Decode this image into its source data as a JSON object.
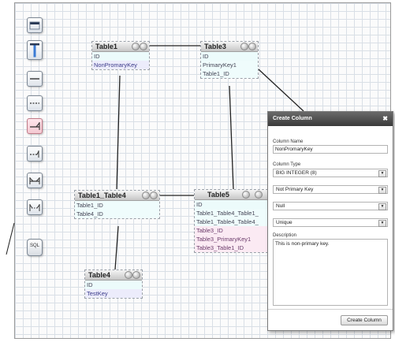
{
  "toolbar": {
    "tools": [
      {
        "name": "new-table-tool"
      },
      {
        "name": "table-column-tool"
      },
      {
        "name": "one-to-one-solid-tool"
      },
      {
        "name": "one-to-one-dashed-tool"
      },
      {
        "name": "one-to-many-solid-tool",
        "active": true
      },
      {
        "name": "one-to-many-dashed-tool"
      },
      {
        "name": "many-to-many-solid-tool"
      },
      {
        "name": "many-to-many-dashed-tool"
      }
    ],
    "sql_label": "SQL"
  },
  "tables": [
    {
      "name": "Table1",
      "rows": [
        {
          "text": "ID",
          "kind": "id"
        },
        {
          "text": "NonPromaryKey",
          "kind": "col"
        }
      ]
    },
    {
      "name": "Table3",
      "rows": [
        {
          "text": "ID",
          "kind": "id"
        },
        {
          "text": "PrimaryKey1",
          "kind": "fk"
        },
        {
          "text": "Table1_ID",
          "kind": "fk"
        }
      ]
    },
    {
      "name": "Table1_Table4",
      "rows": [
        {
          "text": "Table1_ID",
          "kind": "fk"
        },
        {
          "text": "Table4_ID",
          "kind": "fk"
        }
      ]
    },
    {
      "name": "Table5",
      "rows": [
        {
          "text": "ID",
          "kind": "id"
        },
        {
          "text": "Table1_Table4_Table1_",
          "kind": "fk"
        },
        {
          "text": "Table1_Table4_Table4_",
          "kind": "fk"
        },
        {
          "text": "Table3_ID",
          "kind": "pink"
        },
        {
          "text": "Table3_PrimaryKey1",
          "kind": "pink"
        },
        {
          "text": "Table3_Table1_ID",
          "kind": "pink"
        }
      ]
    },
    {
      "name": "Table4",
      "rows": [
        {
          "text": "ID",
          "kind": "id"
        },
        {
          "text": "TestKey",
          "kind": "col"
        }
      ]
    }
  ],
  "dialog": {
    "title": "Create Column",
    "close_icon": "✖",
    "column_name_label": "Column Name",
    "column_name_value": "NonPromaryKey",
    "column_type_label": "Column Type",
    "column_type_value": "BIG INTEGER (8)",
    "key_value": "Not Primary Key",
    "null_value": "Null",
    "unique_value": "Unique",
    "description_label": "Description",
    "description_value": "This is non-primary key.",
    "create_button": "Create Column"
  }
}
